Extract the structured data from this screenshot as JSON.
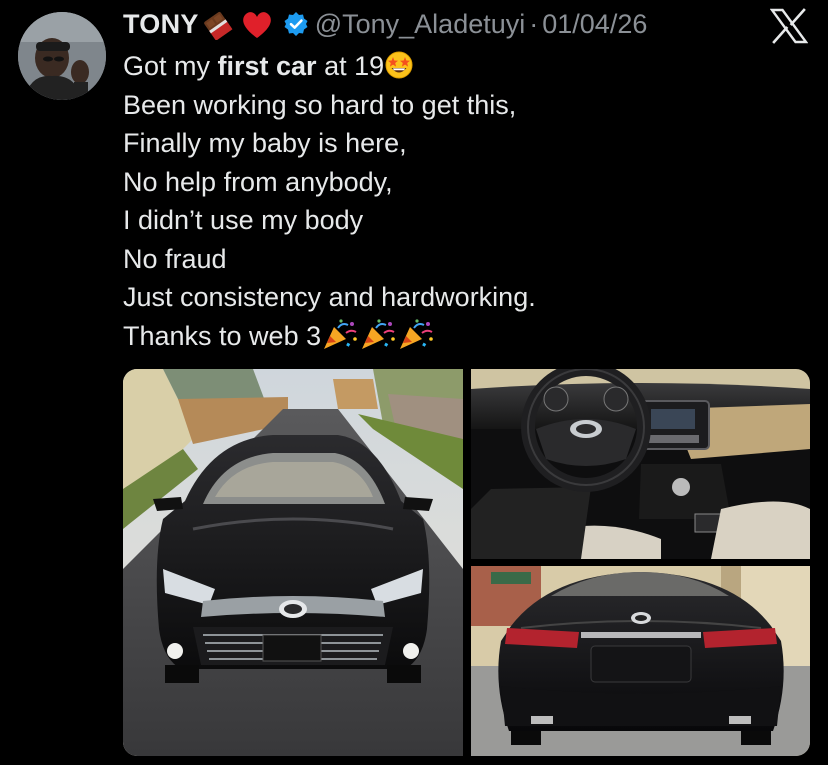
{
  "author": {
    "name": "TONY",
    "handle": "@Tony_Aladetuyi",
    "separator": "·",
    "date": "01/04/26",
    "name_emojis": [
      "chocolate-bar-icon",
      "red-heart-icon"
    ],
    "verified": true
  },
  "platform_logo": "x-logo-icon",
  "tweet": {
    "line1_pre": "Got my ",
    "line1_bold": "first car",
    "line1_post": " at 19",
    "line1_emoji": "star-struck-icon",
    "line2": "Been working so hard to get this,",
    "line3": "Finally my baby is here,",
    "line4": "No help from anybody,",
    "line5": "I didn’t use my body",
    "line6": "No fraud",
    "line7": "Just consistency and hardworking.",
    "line8": "Thanks to web 3",
    "line8_emojis": [
      "party-popper-icon",
      "party-popper-icon",
      "party-popper-icon"
    ]
  },
  "media": [
    {
      "type": "photo",
      "subject": "front-of-black-toyota-avalon"
    },
    {
      "type": "photo",
      "subject": "car-interior-steering-wheel"
    },
    {
      "type": "photo",
      "subject": "rear-of-black-toyota-avalon"
    }
  ],
  "colors": {
    "background": "#000000",
    "text": "#e7e9ea",
    "secondary_text": "#8b9096",
    "verified_blue": "#1d9bf0"
  }
}
